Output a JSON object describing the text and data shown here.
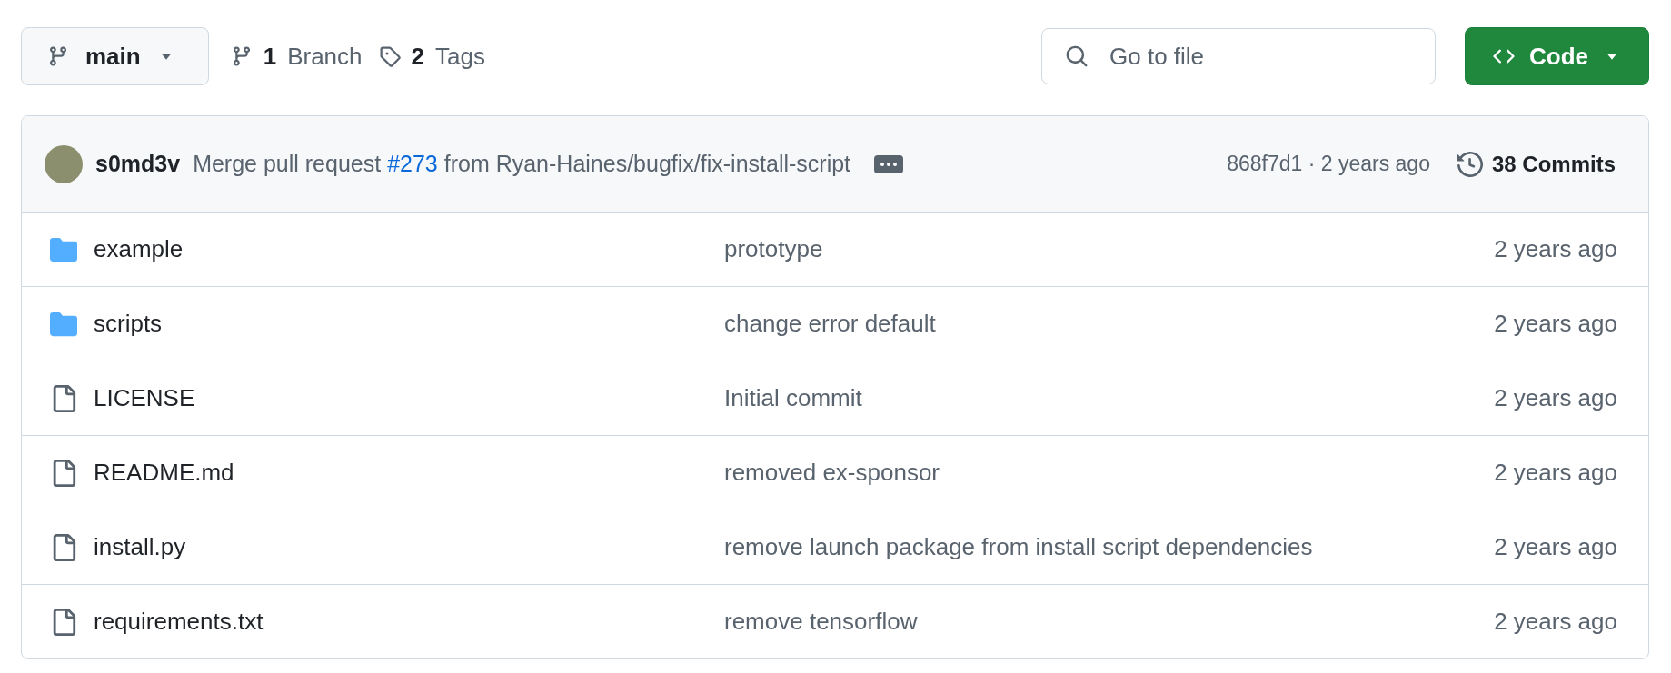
{
  "branch_button": {
    "label": "main"
  },
  "branch_count": {
    "count": "1",
    "label": "Branch"
  },
  "tag_count": {
    "count": "2",
    "label": "Tags"
  },
  "file_search": {
    "placeholder": "Go to file"
  },
  "code_button": {
    "label": "Code"
  },
  "latest_commit": {
    "author": "s0md3v",
    "pr_link": "#273",
    "message_before": "Merge pull request",
    "message_after": "from Ryan-Haines/bugfix/fix-install-script",
    "hash": "868f7d1",
    "separator": "·",
    "time": "2 years ago",
    "commits": "38 Commits"
  },
  "files": [
    {
      "kind": "folder",
      "name": "example",
      "message": "prototype",
      "time": "2 years ago"
    },
    {
      "kind": "folder",
      "name": "scripts",
      "message": "change error default",
      "time": "2 years ago"
    },
    {
      "kind": "file",
      "name": "LICENSE",
      "message": "Initial commit",
      "time": "2 years ago"
    },
    {
      "kind": "file",
      "name": "README.md",
      "message": "removed ex-sponsor",
      "time": "2 years ago"
    },
    {
      "kind": "file",
      "name": "install.py",
      "message": "remove launch package from install script dependencies",
      "time": "2 years ago"
    },
    {
      "kind": "file",
      "name": "requirements.txt",
      "message": "remove tensorflow",
      "time": "2 years ago"
    }
  ]
}
